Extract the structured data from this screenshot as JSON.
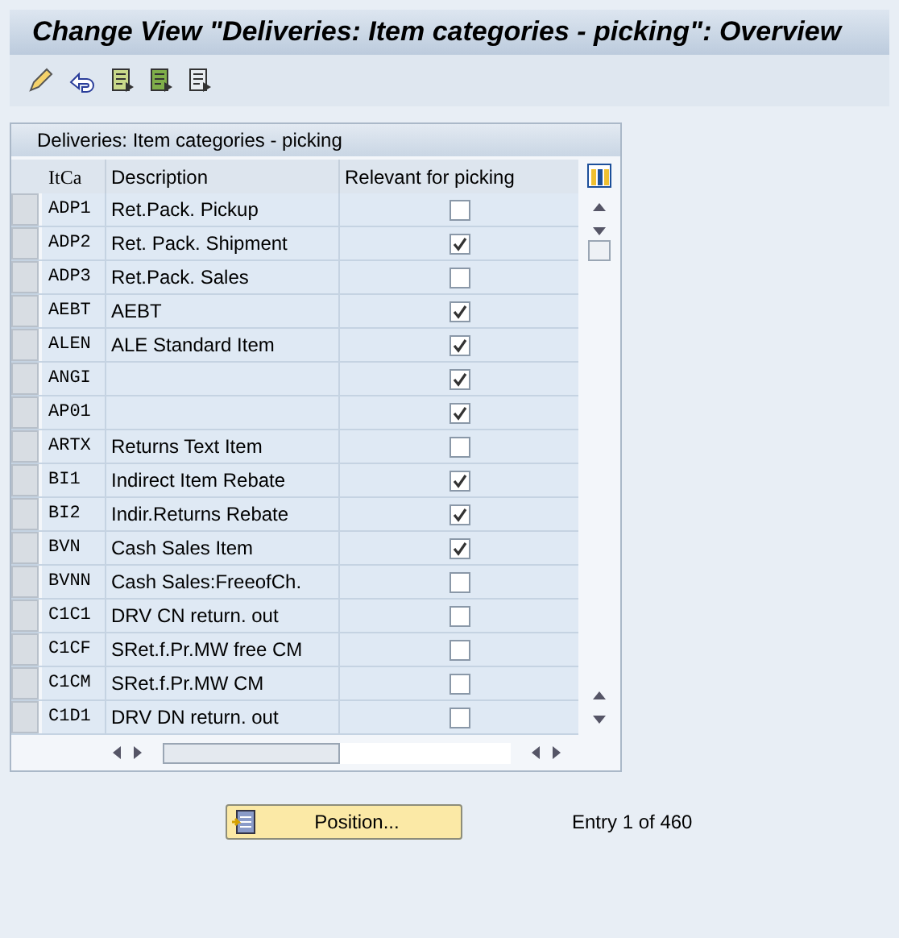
{
  "window": {
    "title": "Change View \"Deliveries: Item categories - picking\": Overview"
  },
  "table": {
    "title": "Deliveries: Item categories - picking",
    "columns": [
      "ItCa",
      "Description",
      "Relevant for picking"
    ],
    "rows": [
      {
        "itca": "ADP1",
        "description": "Ret.Pack. Pickup",
        "checked": false
      },
      {
        "itca": "ADP2",
        "description": "Ret. Pack. Shipment",
        "checked": true
      },
      {
        "itca": "ADP3",
        "description": "Ret.Pack. Sales",
        "checked": false
      },
      {
        "itca": "AEBT",
        "description": "AEBT",
        "checked": true
      },
      {
        "itca": "ALEN",
        "description": "ALE Standard Item",
        "checked": true
      },
      {
        "itca": "ANGI",
        "checked": true
      },
      {
        "itca": "AP01",
        "checked": true
      },
      {
        "itca": "ARTX",
        "description": "Returns Text Item",
        "checked": false
      },
      {
        "itca": "BI1",
        "description": "Indirect Item Rebate",
        "checked": true
      },
      {
        "itca": "BI2",
        "description": "Indir.Returns Rebate",
        "checked": true
      },
      {
        "itca": "BVN",
        "description": "Cash Sales Item",
        "checked": true
      },
      {
        "itca": "BVNN",
        "description": "Cash Sales:FreeofCh.",
        "checked": false
      },
      {
        "itca": "C1C1",
        "description": "DRV CN return. out",
        "checked": false
      },
      {
        "itca": "C1CF",
        "description": "SRet.f.Pr.MW free CM",
        "checked": false
      },
      {
        "itca": "C1CM",
        "description": "SRet.f.Pr.MW CM",
        "checked": false
      },
      {
        "itca": "C1D1",
        "description": "DRV DN return. out",
        "checked": false
      }
    ]
  },
  "position_button": "Position...",
  "entry_info": "Entry 1 of 460"
}
